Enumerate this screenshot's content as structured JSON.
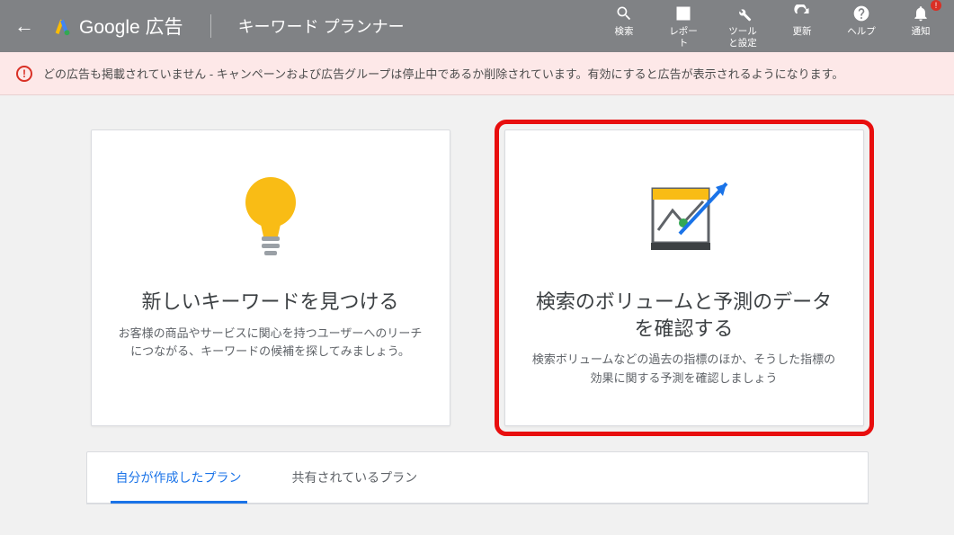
{
  "topbar": {
    "product": "Google 広告",
    "page_title": "キーワード プランナー",
    "actions": {
      "search": "検索",
      "reports": "レポート",
      "tools": "ツールと設定",
      "refresh": "更新",
      "help": "ヘルプ",
      "notifications": "通知"
    },
    "notification_badge": "!"
  },
  "alert": {
    "text": "どの広告も掲載されていません - キャンペーンおよび広告グループは停止中であるか削除されています。有効にすると広告が表示されるようになります。"
  },
  "cards": {
    "find": {
      "title": "新しいキーワードを見つける",
      "desc": "お客様の商品やサービスに関心を持つユーザーへのリーチにつながる、キーワードの候補を探してみましょう。"
    },
    "forecast": {
      "title": "検索のボリュームと予測のデータを確認する",
      "desc": "検索ボリュームなどの過去の指標のほか、そうした指標の効果に関する予測を確認しましょう"
    }
  },
  "tabs": {
    "mine": "自分が作成したプラン",
    "shared": "共有されているプラン"
  }
}
